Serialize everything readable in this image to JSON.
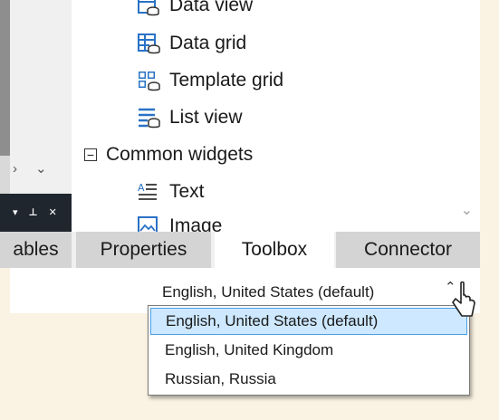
{
  "left_panel": {
    "nav_prev": "›",
    "nav_next": "⌄",
    "pane_menu": "▾",
    "pane_pin": "⊥",
    "pane_close": "✕"
  },
  "toolbox": {
    "items": [
      {
        "label": "Data view",
        "icon": "data-view-icon"
      },
      {
        "label": "Data grid",
        "icon": "data-grid-icon"
      },
      {
        "label": "Template grid",
        "icon": "template-grid-icon"
      },
      {
        "label": "List view",
        "icon": "list-view-icon"
      }
    ],
    "group": {
      "label": "Common widgets",
      "toggle": "−"
    },
    "group_items": [
      {
        "label": "Text",
        "icon": "text-widget-icon"
      },
      {
        "label": "Image",
        "icon": "image-widget-icon"
      }
    ]
  },
  "tabs": [
    {
      "label": "ables",
      "active": false
    },
    {
      "label": "Properties",
      "active": false
    },
    {
      "label": "Toolbox",
      "active": true
    },
    {
      "label": "Connector",
      "active": false
    }
  ],
  "language": {
    "selected": "English, United States (default)",
    "caret": "⌃",
    "options": [
      "English, United States (default)",
      "English, United Kingdom",
      "Russian, Russia"
    ]
  },
  "colors": {
    "accent": "#4aa0e6",
    "selection_bg": "#cde8ff",
    "dark_bar": "#20262e",
    "icon_blue": "#2a72c6"
  }
}
